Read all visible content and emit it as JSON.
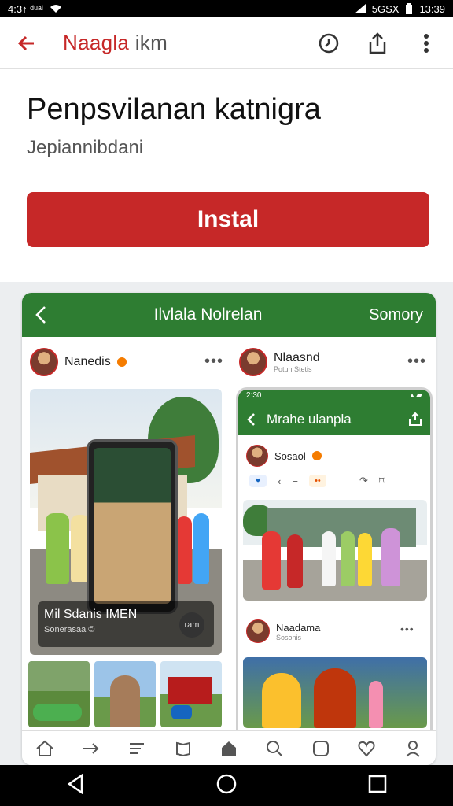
{
  "status": {
    "left_text": "4:3↑ ᵈᵘᵃˡ",
    "right_text": "5GSX",
    "time": "13:39"
  },
  "appbar": {
    "title_main": "Naagla",
    "title_dim": " ikm"
  },
  "app": {
    "name": "Penpsvilanan katnigra",
    "developer": "Jepiannibdani",
    "install_label": "Instal"
  },
  "preview": {
    "title": "Ilvlala Nolrelan",
    "right": "Somory",
    "post1": {
      "name": "Nanedis",
      "caption_title": "Mil Sdanis IMEN",
      "caption_sub": "Sonerasaa ©",
      "caption_btn": "ram"
    },
    "post2": {
      "name": "Nlaasnd",
      "meta": "Potuh Stetis"
    },
    "inner": {
      "status_time": "2:30",
      "title": "Mrahe ulanpla",
      "post_name": "Sosaol",
      "post2_name": "Naadama",
      "post2_meta": "Sosonis"
    },
    "more": "•••"
  }
}
